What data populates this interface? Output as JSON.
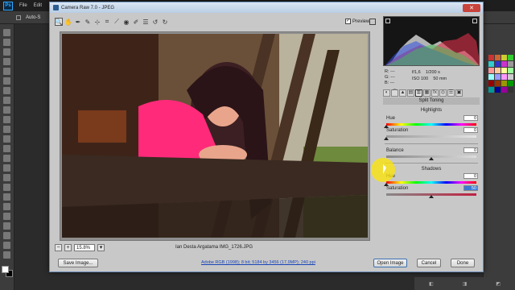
{
  "photoshop": {
    "logo": "Ps",
    "menu": [
      "File",
      "Edit"
    ],
    "options": {
      "auto_select": "Auto-S"
    },
    "swatch_colors": [
      "#c33",
      "#c63",
      "#cc3",
      "#3c3",
      "#3cc",
      "#33c",
      "#c3c",
      "#999",
      "#f99",
      "#fc9",
      "#ff9",
      "#9f9",
      "#9ff",
      "#99f",
      "#f9f",
      "#ccc",
      "#900",
      "#930",
      "#990",
      "#090",
      "#099",
      "#009",
      "#909",
      "#333"
    ]
  },
  "dialog": {
    "title": "Camera Raw 7.0  -  JPEG",
    "close": "✕",
    "preview_label": "Preview",
    "preview_checked": true,
    "tools": [
      "🔍",
      "✋",
      "✒",
      "✎",
      "⊹",
      "⌗",
      "⟋",
      "◉",
      "✐",
      "☰",
      "↺",
      "↻"
    ],
    "zoom": {
      "value": "15.8%",
      "minus": "−",
      "plus": "+",
      "dropdown": "▾"
    },
    "filename": "Ian Desta Argatama IMG_1726.JPG",
    "readouts": {
      "r": "R:  ---",
      "g": "G:  ---",
      "b": "B:  ---",
      "aperture": "f/1,6",
      "shutter": "1/200 s",
      "iso": "ISO 100",
      "focal": "50 mm"
    },
    "panel": {
      "title": "Split Toning",
      "highlights_title": "Highlights",
      "highlights": {
        "hue": {
          "label": "Hue",
          "value": "0",
          "pos": 0
        },
        "saturation": {
          "label": "Saturation",
          "value": "0",
          "pos": 0
        }
      },
      "balance": {
        "label": "Balance",
        "value": "0",
        "pos": 0.5
      },
      "shadows_title": "Shadows",
      "shadows": {
        "hue": {
          "label": "Hue",
          "value": "0",
          "pos": 0
        },
        "saturation": {
          "label": "Saturation",
          "value": "50",
          "pos": 0.5
        }
      }
    },
    "footer": {
      "save": "Save Image...",
      "workflow": "Adobe RGB (1998); 8 bit; 5184 by 3456 (17,9MP); 240 ppi",
      "open": "Open Image",
      "cancel": "Cancel",
      "done": "Done"
    }
  }
}
